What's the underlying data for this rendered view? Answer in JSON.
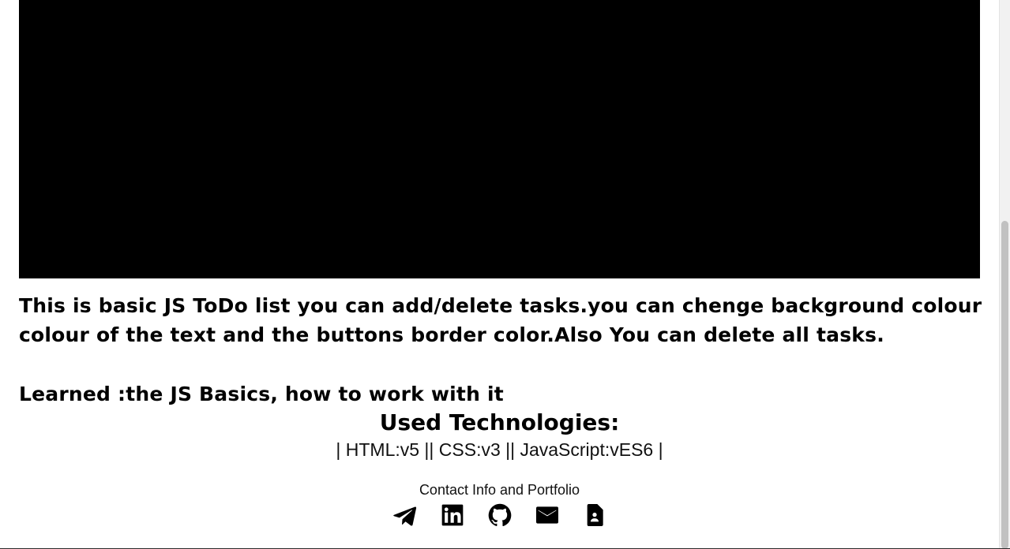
{
  "project": {
    "description": "This is basic JS ToDo list you can add/delete tasks.you can chenge background colour colour of the text and the buttons border color.Also You can delete all tasks.",
    "learned": "Learned :the JS Basics, how to work with it"
  },
  "technologies": {
    "title": "Used Technologies:",
    "list": "| HTML:v5 || CSS:v3 || JavaScript:vES6 |"
  },
  "contact": {
    "label": "Contact Info and Portfolio",
    "icons": [
      "telegram-icon",
      "linkedin-icon",
      "github-icon",
      "email-icon",
      "resume-icon"
    ]
  },
  "colors": {
    "background": "#ffffff",
    "text": "#000000",
    "preview": "#000000",
    "scrollbar_track": "#f1f1f1",
    "scrollbar_thumb": "#c1c1c1"
  }
}
